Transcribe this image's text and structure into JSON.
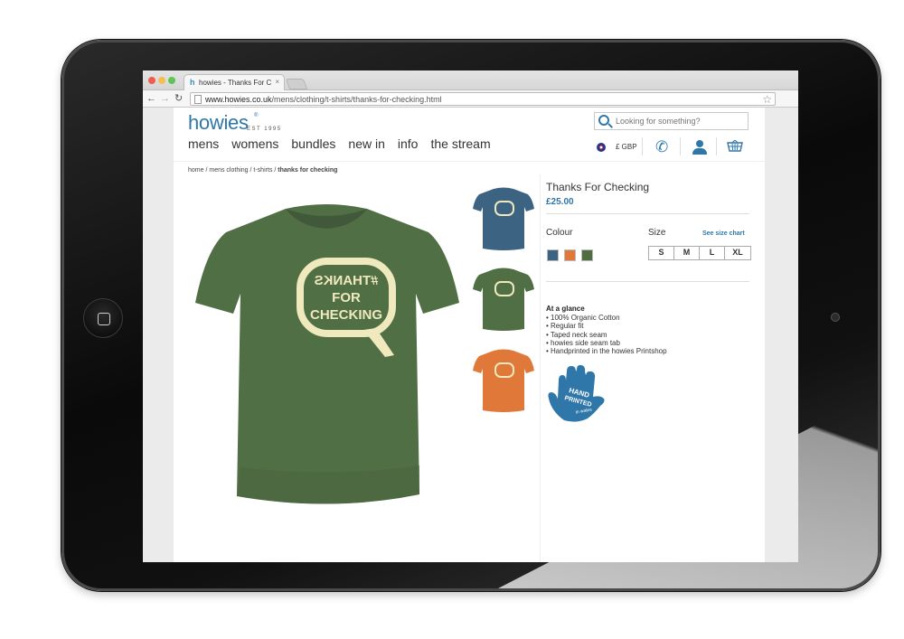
{
  "browser": {
    "tab_title": "howies - Thanks For Checking",
    "tab_favicon": "h",
    "tab_close": "×",
    "url_domain": "www.howies.co.uk",
    "url_path": "/mens/clothing/t-shirts/thanks-for-checking.html",
    "back_icon": "←",
    "forward_icon": "→",
    "reload_icon": "↻",
    "star_icon": "☆"
  },
  "site": {
    "logo": "howies",
    "logo_mark": "®",
    "est": "EST 1995",
    "nav": [
      "mens",
      "womens",
      "bundles",
      "new in",
      "info",
      "the stream"
    ],
    "search_placeholder": "Looking for something?",
    "currency": "£ GBP",
    "phone_icon": "✆"
  },
  "breadcrumb": {
    "items": [
      "home",
      "mens clothing",
      "t-shirts"
    ],
    "separator": " / ",
    "current": "thanks for checking"
  },
  "product": {
    "title": "Thanks For Checking",
    "price": "£25.00",
    "colour_label": "Colour",
    "colours": [
      {
        "name": "blue",
        "hex": "#3d6382"
      },
      {
        "name": "orange",
        "hex": "#e0783a"
      },
      {
        "name": "green",
        "hex": "#4e6e42"
      }
    ],
    "size_label": "Size",
    "size_chart_link": "See size chart",
    "sizes": [
      "S",
      "M",
      "L",
      "XL"
    ],
    "glance_title": "At a glance",
    "glance_items": [
      "• 100% Organic Cotton",
      "• Regular fit",
      "• Taped neck seam",
      "• howies side seam tab",
      "• Handprinted in the howies Printshop"
    ],
    "badge": {
      "line1": "HAND",
      "line2": "PRINTED",
      "line3": "in wales"
    },
    "print_lines": [
      "#THANKS",
      "FOR",
      "CHECKING"
    ]
  },
  "colors": {
    "brand_blue": "#2f77a8",
    "shirt_green": "#516f44",
    "shirt_blue": "#3d6382",
    "shirt_orange": "#e0783a",
    "print_cream": "#efe9bd"
  }
}
